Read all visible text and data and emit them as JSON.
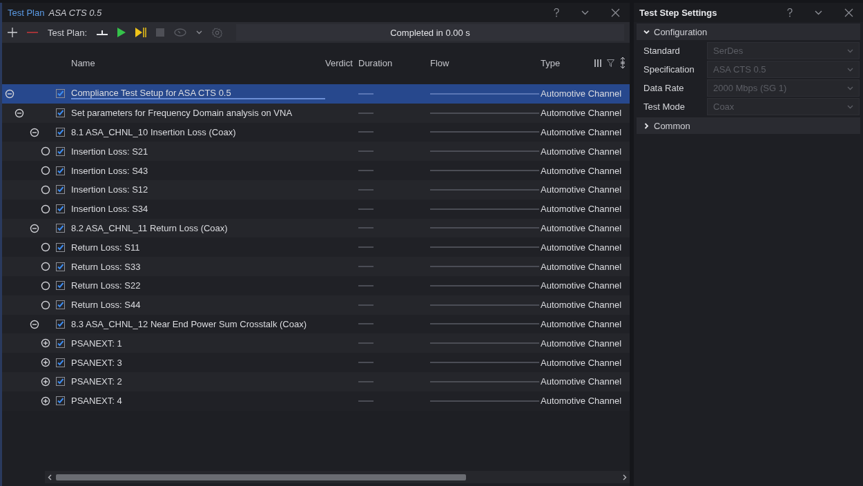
{
  "plan_panel": {
    "title": "Test Plan",
    "plan_name": "ASA CTS 0.5",
    "toolbar": {
      "label": "Test Plan:",
      "status": "Completed in 0.00 s"
    },
    "columns": [
      "Name",
      "Verdict",
      "Duration",
      "Flow",
      "Type"
    ],
    "steps": [
      {
        "name": "Compliance Test Setup for ASA CTS 0.5",
        "type": "Automotive Channel",
        "kind": "group",
        "expanded": true,
        "checked": true,
        "selected": true,
        "children": [
          {
            "name": "Set parameters for Frequency Domain analysis on VNA",
            "type": "Automotive Channel",
            "kind": "group",
            "expanded": true,
            "checked": true,
            "selected": false,
            "children": [
              {
                "name": "8.1 ASA_CHNL_10 Insertion Loss (Coax)",
                "type": "Automotive Channel",
                "kind": "group",
                "expanded": true,
                "checked": true,
                "selected": false,
                "children": [
                  {
                    "name": "Insertion Loss: S21",
                    "type": "Automotive Channel",
                    "kind": "step",
                    "checked": true,
                    "selected": false
                  },
                  {
                    "name": "Insertion Loss: S43",
                    "type": "Automotive Channel",
                    "kind": "step",
                    "checked": true,
                    "selected": false
                  },
                  {
                    "name": "Insertion Loss: S12",
                    "type": "Automotive Channel",
                    "kind": "step",
                    "checked": true,
                    "selected": false
                  },
                  {
                    "name": "Insertion Loss: S34",
                    "type": "Automotive Channel",
                    "kind": "step",
                    "checked": true,
                    "selected": false
                  }
                ]
              },
              {
                "name": "8.2 ASA_CHNL_11 Return Loss (Coax)",
                "type": "Automotive Channel",
                "kind": "group",
                "expanded": true,
                "checked": true,
                "selected": false,
                "children": [
                  {
                    "name": "Return Loss: S11",
                    "type": "Automotive Channel",
                    "kind": "step",
                    "checked": true,
                    "selected": false
                  },
                  {
                    "name": "Return Loss: S33",
                    "type": "Automotive Channel",
                    "kind": "step",
                    "checked": true,
                    "selected": false
                  },
                  {
                    "name": "Return Loss: S22",
                    "type": "Automotive Channel",
                    "kind": "step",
                    "checked": true,
                    "selected": false
                  },
                  {
                    "name": "Return Loss: S44",
                    "type": "Automotive Channel",
                    "kind": "step",
                    "checked": true,
                    "selected": false
                  }
                ]
              },
              {
                "name": "8.3 ASA_CHNL_12 Near End Power Sum Crosstalk (Coax)",
                "type": "Automotive Channel",
                "kind": "group",
                "expanded": true,
                "checked": true,
                "selected": false,
                "children": [
                  {
                    "name": "PSANEXT: 1",
                    "type": "Automotive Channel",
                    "kind": "group",
                    "expanded": false,
                    "checked": true,
                    "selected": false
                  },
                  {
                    "name": "PSANEXT: 3",
                    "type": "Automotive Channel",
                    "kind": "group",
                    "expanded": false,
                    "checked": true,
                    "selected": false
                  },
                  {
                    "name": "PSANEXT: 2",
                    "type": "Automotive Channel",
                    "kind": "group",
                    "expanded": false,
                    "checked": true,
                    "selected": false
                  },
                  {
                    "name": "PSANEXT: 4",
                    "type": "Automotive Channel",
                    "kind": "group",
                    "expanded": false,
                    "checked": true,
                    "selected": false
                  }
                ]
              }
            ]
          }
        ]
      }
    ]
  },
  "settings_panel": {
    "title": "Test Step Settings",
    "sections": [
      {
        "label": "Configuration",
        "expanded": true,
        "properties": [
          {
            "label": "Standard",
            "value": "SerDes",
            "disabled": true
          },
          {
            "label": "Specification",
            "value": "ASA CTS 0.5",
            "disabled": true
          },
          {
            "label": "Data Rate",
            "value": "2000 Mbps (SG 1)",
            "disabled": true
          },
          {
            "label": "Test Mode",
            "value": "Coax",
            "disabled": true
          }
        ]
      },
      {
        "label": "Common",
        "expanded": false
      }
    ]
  }
}
